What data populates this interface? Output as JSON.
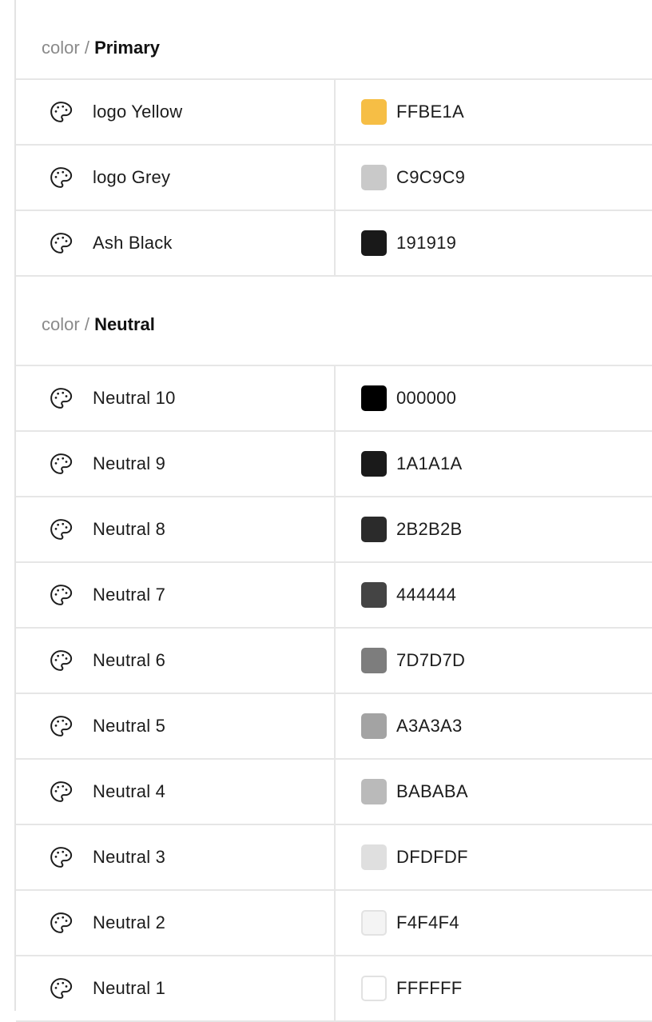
{
  "groups": [
    {
      "prefix": "color",
      "separator": "/",
      "name": "Primary",
      "items": [
        {
          "label": "logo Yellow",
          "hex": "FFBE1A",
          "swatch": "#F6BE45"
        },
        {
          "label": "logo Grey",
          "hex": "C9C9C9",
          "swatch": "#C9C9C9"
        },
        {
          "label": "Ash Black",
          "hex": "191919",
          "swatch": "#191919"
        }
      ]
    },
    {
      "prefix": "color",
      "separator": "/",
      "name": "Neutral",
      "items": [
        {
          "label": "Neutral 10",
          "hex": "000000",
          "swatch": "#000000"
        },
        {
          "label": "Neutral 9",
          "hex": "1A1A1A",
          "swatch": "#1A1A1A"
        },
        {
          "label": "Neutral 8",
          "hex": "2B2B2B",
          "swatch": "#2B2B2B"
        },
        {
          "label": "Neutral 7",
          "hex": "444444",
          "swatch": "#444444"
        },
        {
          "label": "Neutral 6",
          "hex": "7D7D7D",
          "swatch": "#7D7D7D"
        },
        {
          "label": "Neutral 5",
          "hex": "A3A3A3",
          "swatch": "#A3A3A3"
        },
        {
          "label": "Neutral 4",
          "hex": "BABABA",
          "swatch": "#BABABA"
        },
        {
          "label": "Neutral 3",
          "hex": "DFDFDF",
          "swatch": "#DFDFDF"
        },
        {
          "label": "Neutral 2",
          "hex": "F4F4F4",
          "swatch": "#F4F4F4",
          "bordered": true
        },
        {
          "label": "Neutral 1",
          "hex": "FFFFFF",
          "swatch": "#FFFFFF",
          "bordered": true
        }
      ]
    }
  ],
  "icon": "palette-icon"
}
